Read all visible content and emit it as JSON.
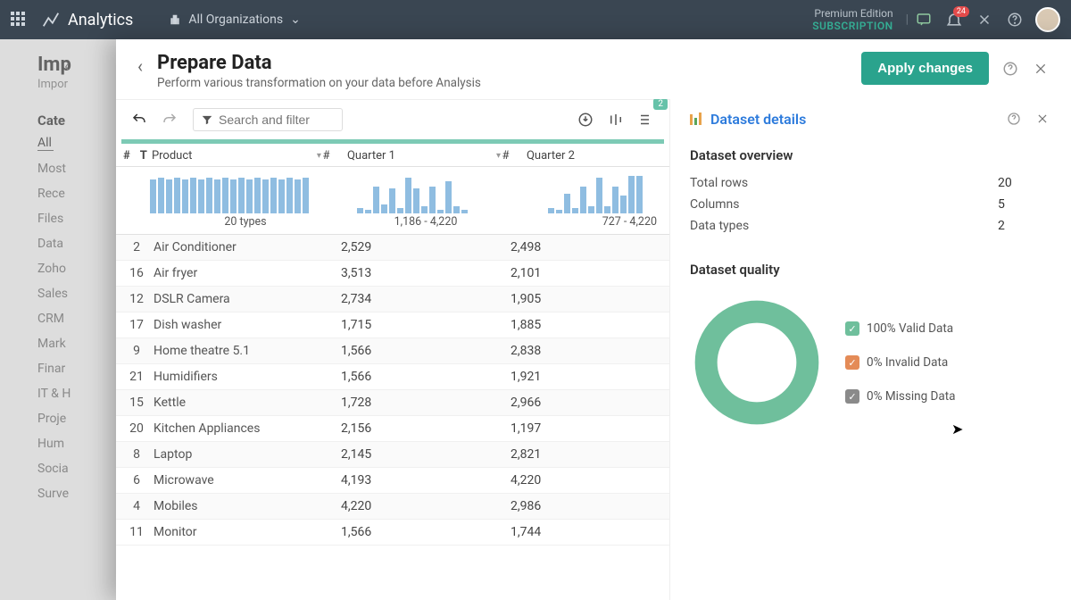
{
  "topbar": {
    "brand": "Analytics",
    "org_label": "All Organizations",
    "premium_line1": "Premium Edition",
    "premium_line2": "SUBSCRIPTION",
    "notif_badge": "24"
  },
  "bg": {
    "title": "Imp",
    "subtitle": "Impor",
    "cat_heading": "Cate",
    "items": [
      "All",
      "Most",
      "Rece",
      "Files",
      "Data",
      "Zoho",
      "Sales",
      "CRM",
      "Mark",
      "Finar",
      "IT & H",
      "Proje",
      "Hum",
      "Socia",
      "Surve"
    ]
  },
  "sheet": {
    "title": "Prepare Data",
    "subtitle": "Perform various transformation on your data before Analysis",
    "apply_label": "Apply changes",
    "search_placeholder": "Search and filter",
    "badge_count": "2",
    "columns": {
      "idx": "#",
      "type": "T",
      "product": "Product",
      "q1": "Quarter 1",
      "q2": "Quarter 2",
      "numicon": "#"
    },
    "histo_captions": {
      "product": "20 types",
      "q1": "1,186 - 4,220",
      "q2": "727 - 4,220"
    },
    "rows": [
      {
        "idx": "2",
        "product": "Air Conditioner",
        "q1": "2,529",
        "q2": "2,498"
      },
      {
        "idx": "16",
        "product": "Air fryer",
        "q1": "3,513",
        "q2": "2,101"
      },
      {
        "idx": "12",
        "product": "DSLR Camera",
        "q1": "2,734",
        "q2": "1,905"
      },
      {
        "idx": "17",
        "product": "Dish washer",
        "q1": "1,715",
        "q2": "1,885"
      },
      {
        "idx": "9",
        "product": "Home theatre 5.1",
        "q1": "1,566",
        "q2": "2,838"
      },
      {
        "idx": "21",
        "product": "Humidifiers",
        "q1": "1,566",
        "q2": "1,921"
      },
      {
        "idx": "15",
        "product": "Kettle",
        "q1": "1,728",
        "q2": "2,966"
      },
      {
        "idx": "20",
        "product": "Kitchen Appliances",
        "q1": "2,156",
        "q2": "1,197"
      },
      {
        "idx": "8",
        "product": "Laptop",
        "q1": "2,145",
        "q2": "2,821"
      },
      {
        "idx": "6",
        "product": "Microwave",
        "q1": "4,193",
        "q2": "4,220"
      },
      {
        "idx": "4",
        "product": "Mobiles",
        "q1": "4,220",
        "q2": "2,986"
      },
      {
        "idx": "11",
        "product": "Monitor",
        "q1": "1,566",
        "q2": "1,744"
      }
    ]
  },
  "details": {
    "title": "Dataset details",
    "overview_heading": "Dataset overview",
    "rows_label": "Total rows",
    "rows_val": "20",
    "cols_label": "Columns",
    "cols_val": "5",
    "types_label": "Data types",
    "types_val": "2",
    "quality_heading": "Dataset quality",
    "legend": {
      "valid": "100% Valid Data",
      "invalid": "0% Invalid Data",
      "missing": "0% Missing Data"
    }
  },
  "chart_data": {
    "type": "pie",
    "title": "Dataset quality",
    "series": [
      {
        "name": "Valid Data",
        "value": 100,
        "color": "#6fbf9c"
      },
      {
        "name": "Invalid Data",
        "value": 0,
        "color": "#e48b57"
      },
      {
        "name": "Missing Data",
        "value": 0,
        "color": "#8a8a8a"
      }
    ]
  },
  "histograms": {
    "product_bars": [
      38,
      40,
      38,
      40,
      38,
      40,
      38,
      40,
      38,
      40,
      38,
      40,
      38,
      40,
      38,
      40,
      38,
      40,
      38,
      40
    ],
    "q1_bars": [
      6,
      4,
      30,
      10,
      28,
      6,
      40,
      28,
      8,
      30,
      4,
      36,
      8,
      4
    ],
    "q2_bars": [
      6,
      4,
      22,
      6,
      30,
      8,
      40,
      8,
      30,
      20,
      42,
      42
    ]
  }
}
